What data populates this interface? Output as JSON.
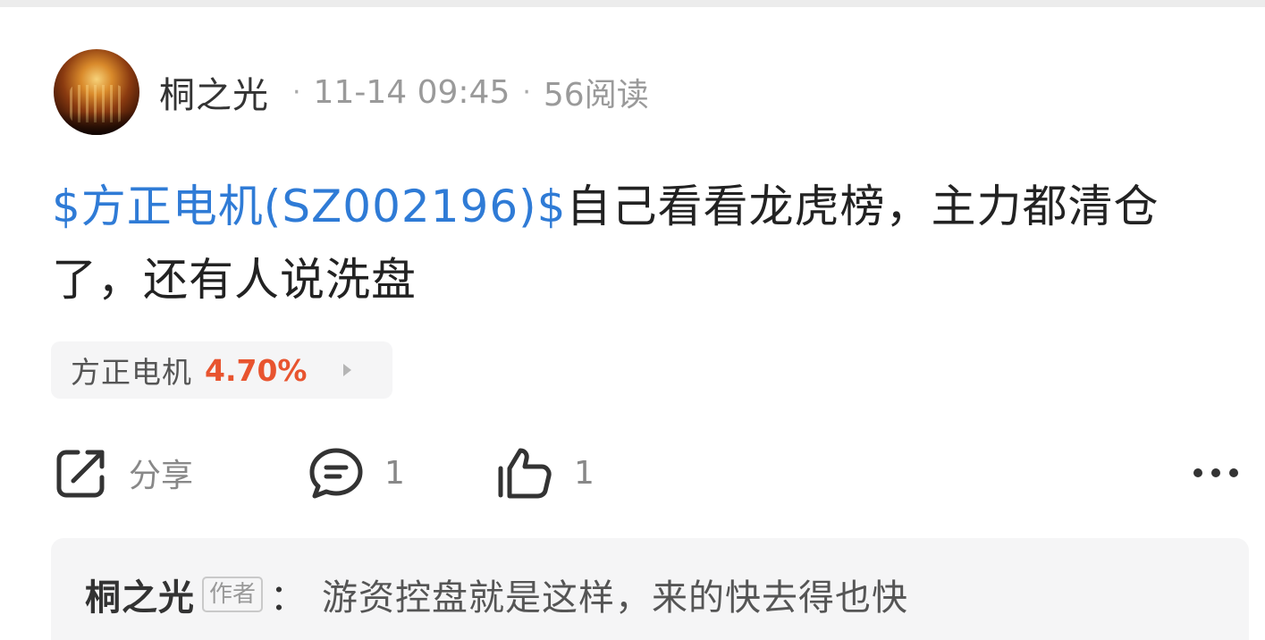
{
  "post": {
    "author": "桐之光",
    "date_time": "11-14 09:45",
    "read_count": "56阅读",
    "meta_separator": "·",
    "content": {
      "stock_link": "$方正电机(SZ002196)$",
      "text": "自己看看龙虎榜，主力都清仓了，还有人说洗盘"
    }
  },
  "stock_chip": {
    "name": "方正电机",
    "change_pct": "4.70%"
  },
  "actions": {
    "share_label": "分享",
    "comment_count": "1",
    "like_count": "1"
  },
  "comment": {
    "author": "桐之光",
    "author_tag": "作者",
    "colon": "：",
    "text": "游资控盘就是这样，来的快去得也快"
  },
  "colors": {
    "stock_link": "#2f7bd6",
    "change_up": "#e8542f",
    "card_background": "#f5f5f6"
  },
  "icons": {
    "share": "share-icon",
    "comment": "comment-icon",
    "like": "thumbs-up-icon",
    "more": "more-icon",
    "chip_arrow": "triangle-right-icon"
  }
}
